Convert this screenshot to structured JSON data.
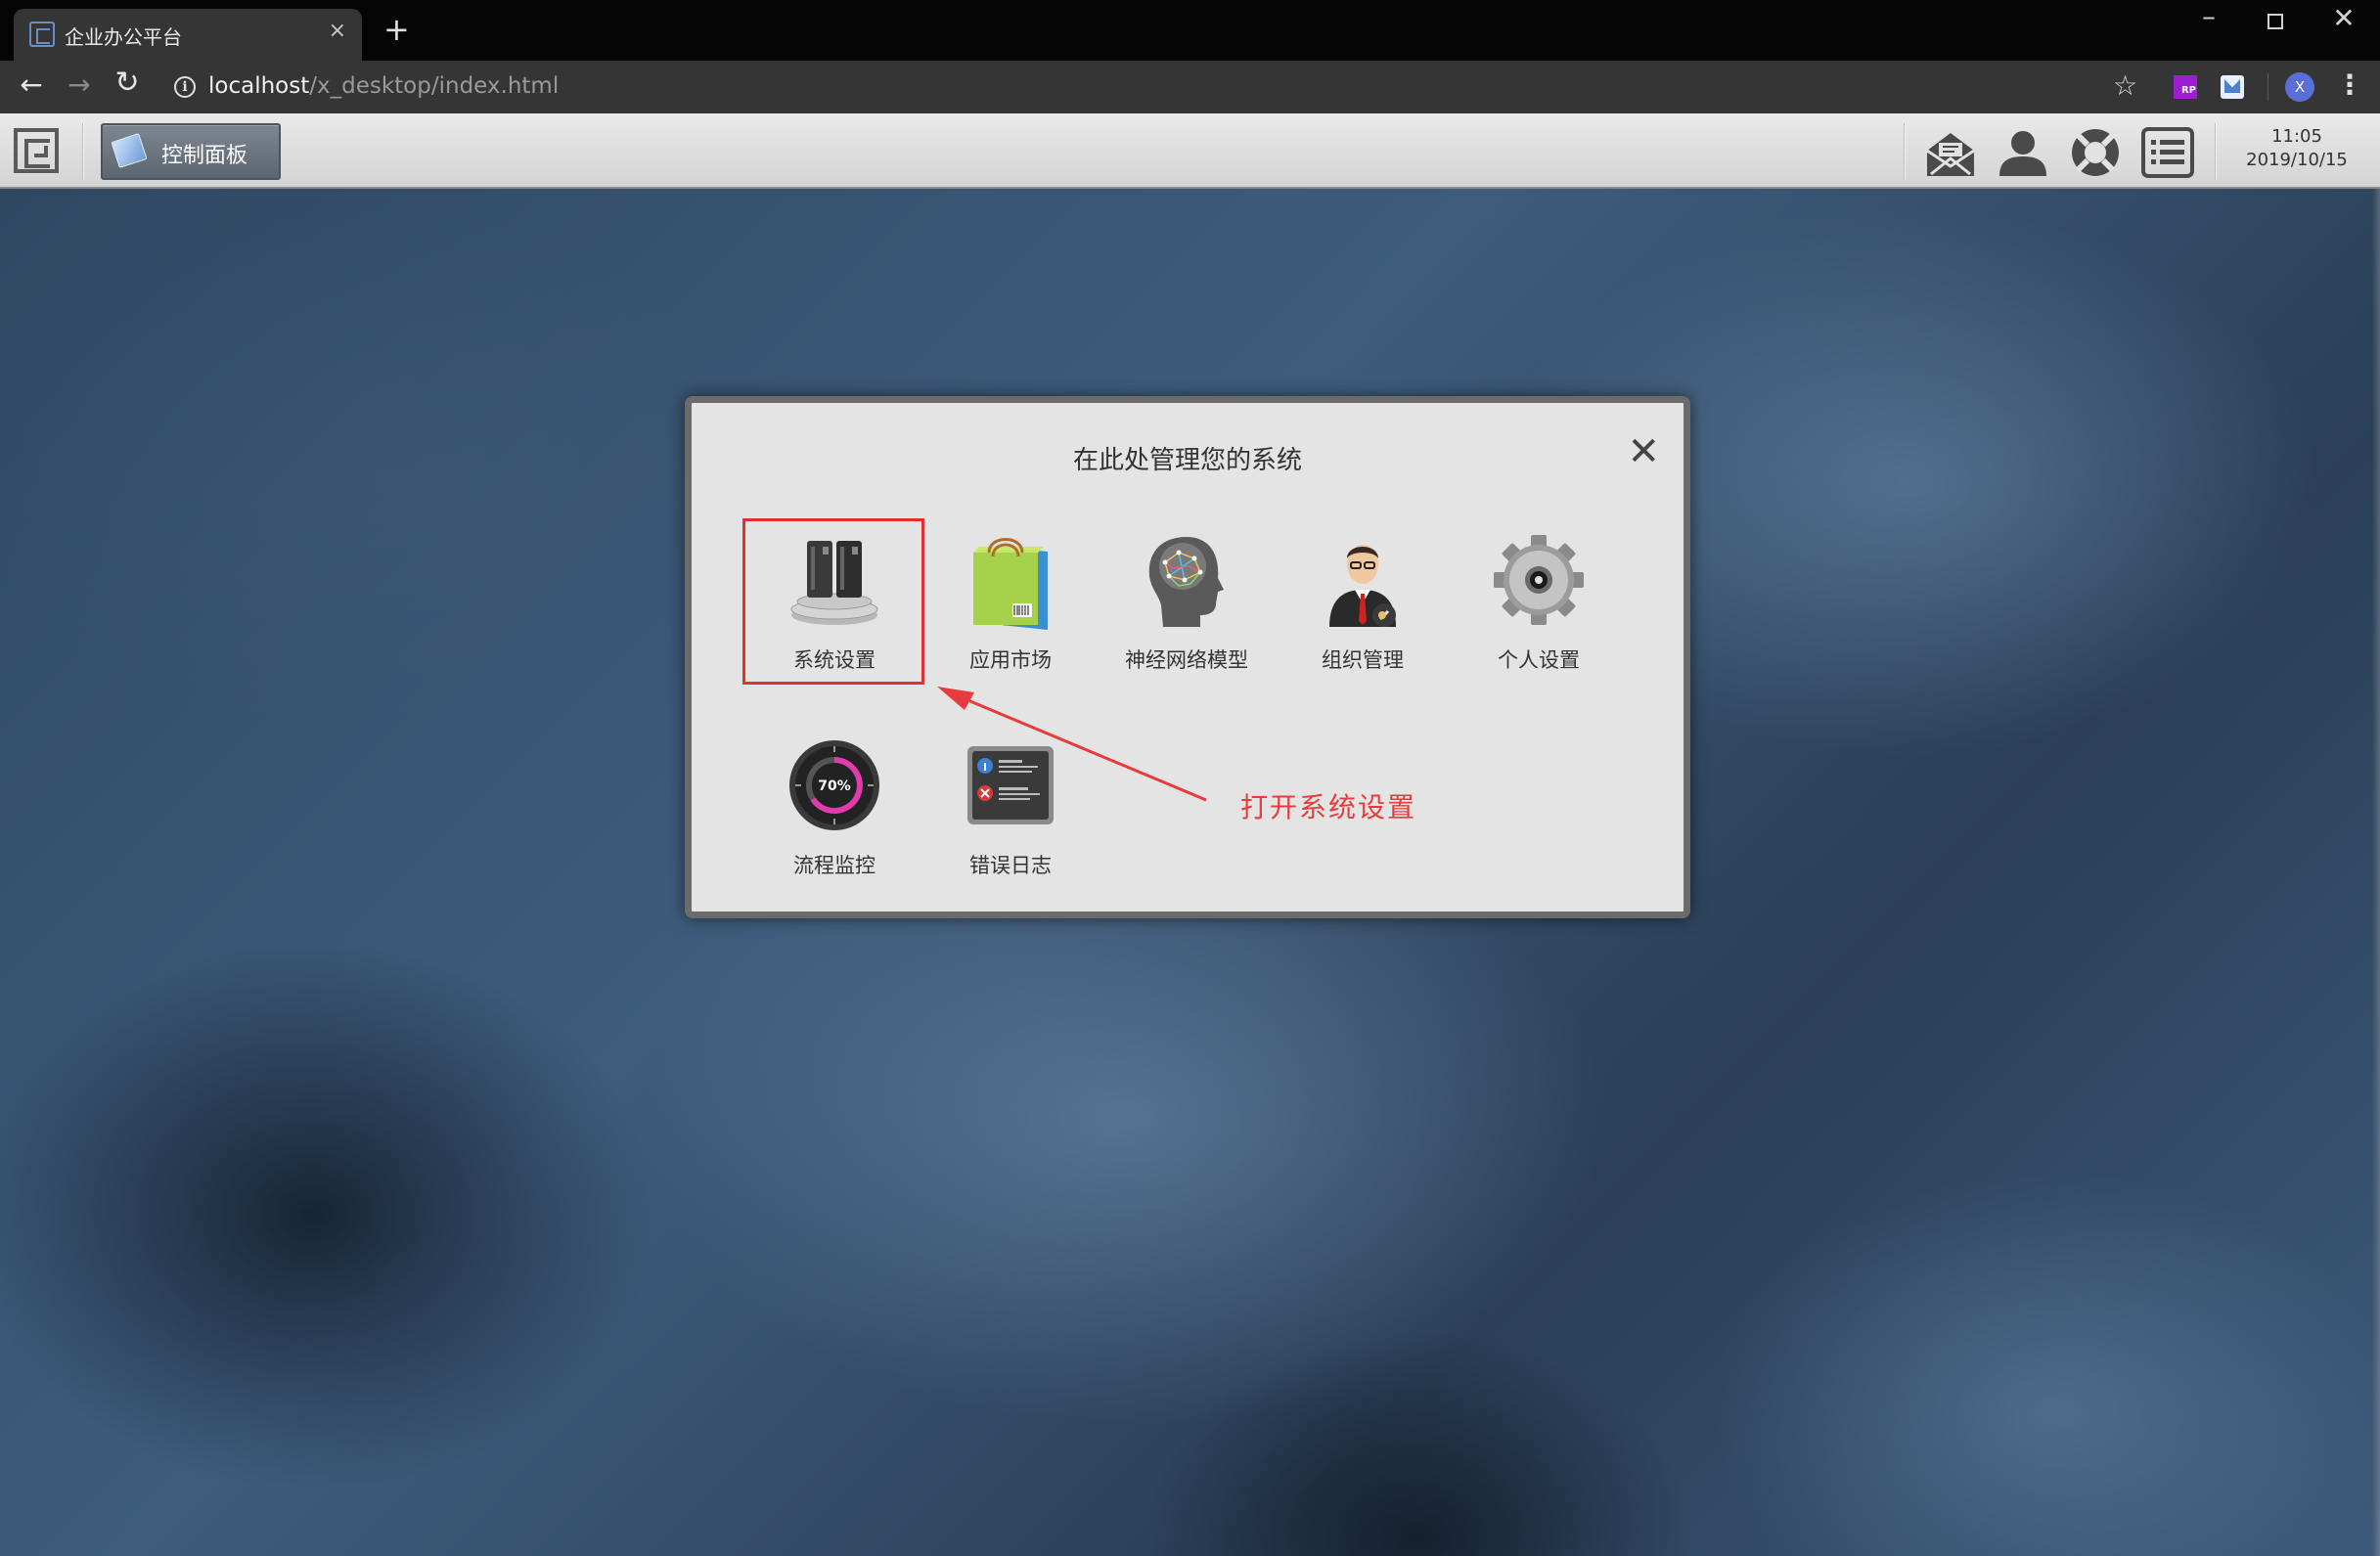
{
  "browser": {
    "tab_title": "企业办公平台",
    "tab_close": "×",
    "new_tab": "+",
    "url_host": "localhost",
    "url_path": "/x_desktop/index.html",
    "profile_initial": "X",
    "ext_rp_label": "RP",
    "window_min": "–",
    "window_close": "✕"
  },
  "taskbar": {
    "active_task_label": "控制面板",
    "icons": [
      "mail-icon",
      "user-icon",
      "help-lifebuoy-icon",
      "list-icon"
    ],
    "clock_time": "11:05",
    "clock_date": "2019/10/15"
  },
  "dialog": {
    "title": "在此处管理您的系统",
    "close_glyph": "✕",
    "items": [
      {
        "label": "系统设置",
        "icon": "server-settings-icon"
      },
      {
        "label": "应用市场",
        "icon": "shopping-bag-icon"
      },
      {
        "label": "神经网络模型",
        "icon": "brain-icon"
      },
      {
        "label": "组织管理",
        "icon": "manager-person-icon"
      },
      {
        "label": "个人设置",
        "icon": "gear-icon"
      },
      {
        "label": "流程监控",
        "icon": "gauge-icon"
      },
      {
        "label": "错误日志",
        "icon": "error-log-icon"
      }
    ]
  },
  "annotation": {
    "text": "打开系统设置",
    "color": "#e83b3b"
  },
  "colors": {
    "highlight_border": "#e3312f",
    "taskbar_active": "#6a737d"
  }
}
